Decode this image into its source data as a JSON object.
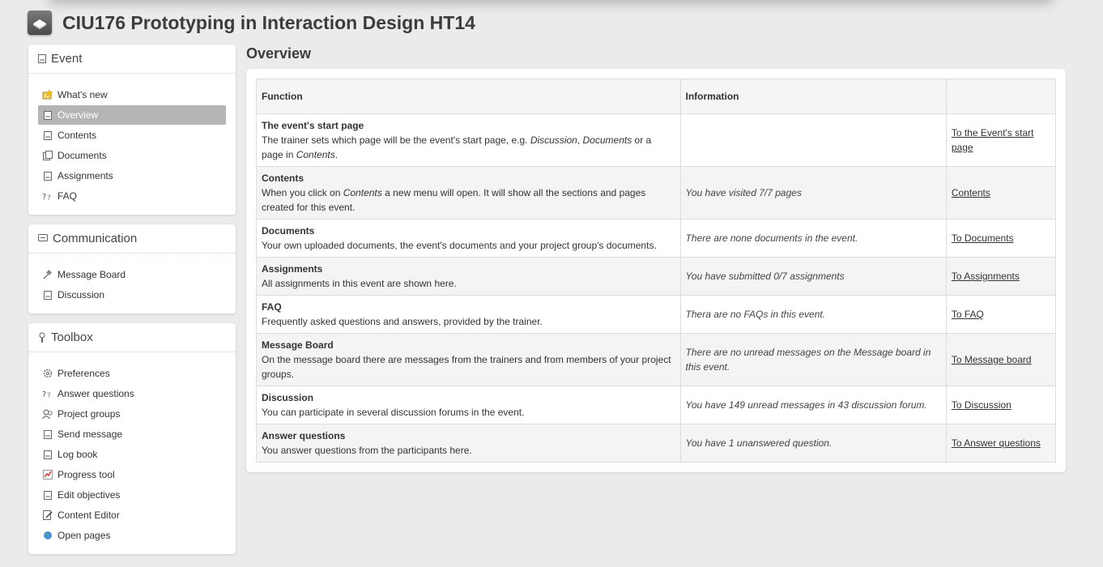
{
  "header": {
    "title": "CIU176 Prototyping in Interaction Design HT14"
  },
  "sidebar": {
    "event": {
      "title": "Event",
      "items": [
        {
          "label": "What's new",
          "icon": "star-note-icon"
        },
        {
          "label": "Overview",
          "icon": "page-icon",
          "active": true
        },
        {
          "label": "Contents",
          "icon": "page-icon"
        },
        {
          "label": "Documents",
          "icon": "documents-icon"
        },
        {
          "label": "Assignments",
          "icon": "page-icon"
        },
        {
          "label": "FAQ",
          "icon": "faq-icon"
        }
      ]
    },
    "communication": {
      "title": "Communication",
      "items": [
        {
          "label": "Message Board",
          "icon": "pin-icon"
        },
        {
          "label": "Discussion",
          "icon": "page-icon"
        }
      ]
    },
    "toolbox": {
      "title": "Toolbox",
      "items": [
        {
          "label": "Preferences",
          "icon": "gear-icon"
        },
        {
          "label": "Answer questions",
          "icon": "faq-icon"
        },
        {
          "label": "Project groups",
          "icon": "group-icon"
        },
        {
          "label": "Send message",
          "icon": "page-icon"
        },
        {
          "label": "Log book",
          "icon": "page-icon"
        },
        {
          "label": "Progress tool",
          "icon": "chart-icon"
        },
        {
          "label": "Edit objectives",
          "icon": "page-icon"
        },
        {
          "label": "Content Editor",
          "icon": "edit-icon"
        },
        {
          "label": "Open pages",
          "icon": "globe-icon"
        }
      ]
    }
  },
  "main": {
    "title": "Overview",
    "table": {
      "headers": [
        "Function",
        "Information",
        ""
      ],
      "rows": [
        {
          "name": "The event's start page",
          "desc_html": "The trainer sets which page will be the event's start page, e.g. <i>Discussion</i>, <i>Documents</i> or a page in <i>Contents</i>.",
          "info": "",
          "link": "To the Event's start page"
        },
        {
          "name": "Contents",
          "desc_html": "When you click on <i>Contents</i> a new menu will open. It will show all the sections and pages created for this event.",
          "info": "You have visited 7/7 pages",
          "link": "Contents"
        },
        {
          "name": "Documents",
          "desc_html": "Your own uploaded documents, the event's documents and your project group's documents.",
          "info": "There are none documents in the event.",
          "link": "To Documents"
        },
        {
          "name": "Assignments",
          "desc_html": "All assignments in this event are shown here.",
          "info": "You have submitted 0/7 assignments",
          "link": "To Assignments"
        },
        {
          "name": "FAQ",
          "desc_html": "Frequently asked questions and answers, provided by the trainer.",
          "info": "Thera are no FAQs in this event.",
          "link": "To FAQ"
        },
        {
          "name": "Message Board",
          "desc_html": "On the message board there are messages from the trainers and from members of your project groups.",
          "info": "There are no unread messages on the Message board in this event.",
          "link": "To Message board"
        },
        {
          "name": "Discussion",
          "desc_html": "You can participate in several discussion forums in the event.",
          "info": "You have 149 unread messages in 43 discussion forum.",
          "link": "To Discussion"
        },
        {
          "name": "Answer questions",
          "desc_html": "You answer questions from the participants here.",
          "info": "You have 1 unanswered question.",
          "link": "To Answer questions"
        }
      ]
    }
  }
}
